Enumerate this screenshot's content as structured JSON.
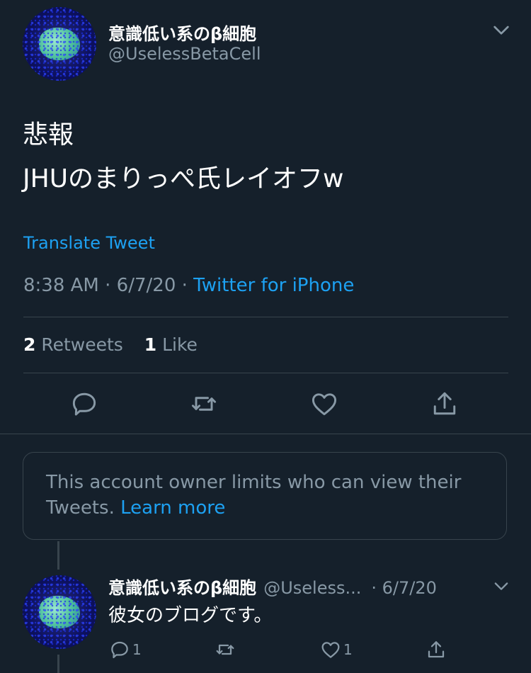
{
  "tweet": {
    "display_name": "意識低い系のβ細胞",
    "handle": "@UselessBetaCell",
    "text_line1": "悲報",
    "text_line2": "JHUのまりっぺ氏レイオフw",
    "translate_label": "Translate Tweet",
    "time": "8:38 AM",
    "date": "6/7/20",
    "source": "Twitter for iPhone",
    "retweet_count": "2",
    "retweets_label": "Retweets",
    "like_count": "1",
    "likes_label": "Like"
  },
  "notice": {
    "text": "This account owner limits who can view their Tweets.",
    "link": "Learn more"
  },
  "reply": {
    "display_name": "意識低い系のβ細胞",
    "handle": "@Useless...",
    "date": "6/7/20",
    "text": "彼女のブログです。",
    "reply_count": "1",
    "like_count": "1"
  },
  "colors": {
    "background": "#15202b",
    "accent": "#1da1f2",
    "muted": "#8899a6",
    "divider": "#38444d"
  }
}
